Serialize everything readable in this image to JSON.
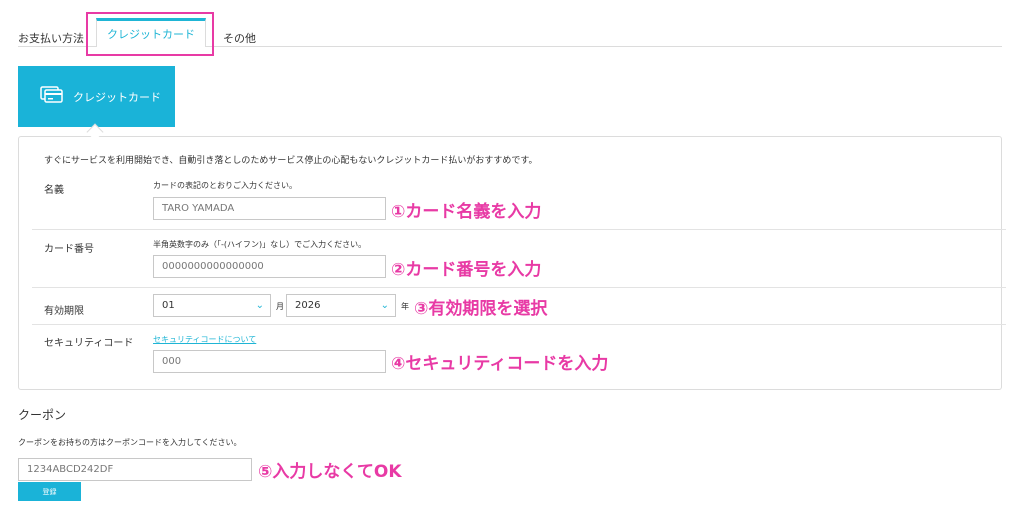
{
  "tabs": {
    "section_label": "お支払い方法",
    "credit": "クレジットカード",
    "other": "その他"
  },
  "credit_tile": {
    "label": "クレジットカード",
    "icon": "credit-card-icon"
  },
  "intro": "すぐにサービスを利用開始でき、自動引き落としのためサービス停止の心配もないクレジットカード払いがおすすめです。",
  "name_row": {
    "label": "名義",
    "hint": "カードの表記のとおりご入力ください。",
    "placeholder": "TARO YAMADA",
    "annotation": "①カード名義を入力"
  },
  "number_row": {
    "label": "カード番号",
    "hint": "半角英数字のみ（「-(ハイフン)」なし）でご入力ください。",
    "placeholder": "0000000000000000",
    "annotation": "②カード番号を入力"
  },
  "expiry_row": {
    "label": "有効期限",
    "month_value": "01",
    "month_unit": "月",
    "year_value": "2026",
    "year_unit": "年",
    "annotation": "③有効期限を選択"
  },
  "security_row": {
    "label": "セキュリティコード",
    "link": "セキュリティコードについて",
    "placeholder": "000",
    "annotation": "④セキュリティコードを入力"
  },
  "coupon": {
    "title": "クーポン",
    "desc": "クーポンをお持ちの方はクーポンコードを入力してください。",
    "placeholder": "1234ABCD242DF",
    "annotation": "⑤入力しなくてOK",
    "button": "登録"
  },
  "colors": {
    "accent": "#1ab3d8",
    "annotation": "#e83aa5"
  }
}
